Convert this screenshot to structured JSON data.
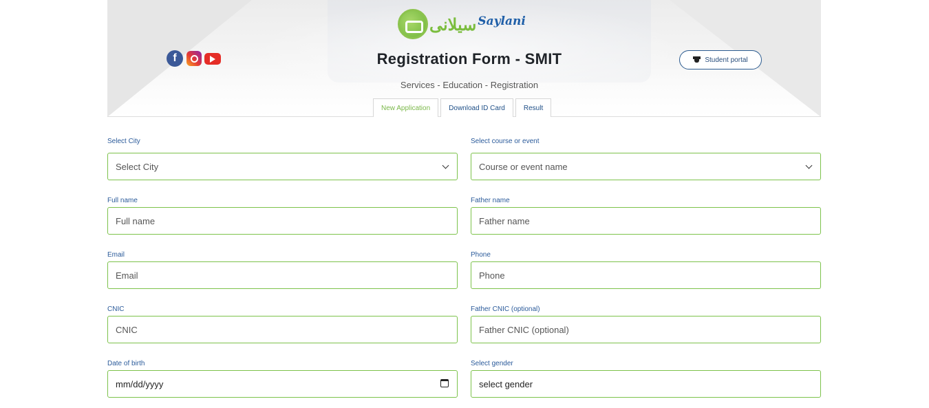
{
  "header": {
    "logo_urdu": "سیلانی",
    "logo_latin": "Saylani",
    "title": "Registration Form - SMIT",
    "subtitle": "Services - Education - Registration",
    "portal_button": "Student portal"
  },
  "social": [
    {
      "name": "facebook-icon",
      "glyph": "f"
    },
    {
      "name": "instagram-icon"
    },
    {
      "name": "youtube-icon"
    }
  ],
  "tabs": [
    {
      "label": "New Application",
      "active": true
    },
    {
      "label": "Download ID Card",
      "active": false
    },
    {
      "label": "Result",
      "active": false
    }
  ],
  "form": {
    "city": {
      "label": "Select City",
      "placeholder": "Select City"
    },
    "course": {
      "label": "Select course or event",
      "placeholder": "Course or event name"
    },
    "full_name": {
      "label": "Full name",
      "placeholder": "Full name"
    },
    "father_name": {
      "label": "Father name",
      "placeholder": "Father name"
    },
    "email": {
      "label": "Email",
      "placeholder": "Email"
    },
    "phone": {
      "label": "Phone",
      "placeholder": "Phone"
    },
    "cnic": {
      "label": "CNIC",
      "placeholder": "CNIC"
    },
    "father_cnic": {
      "label": "Father CNIC (optional)",
      "placeholder": "Father CNIC (optional)"
    },
    "dob": {
      "label": "Date of birth",
      "placeholder": "mm/dd/yyyy"
    },
    "gender": {
      "label": "Select gender",
      "value": "select gender"
    }
  },
  "colors": {
    "accent_green": "#7cc24a",
    "label_blue": "#2a5a9a",
    "portal_border": "#2a5a8f"
  }
}
